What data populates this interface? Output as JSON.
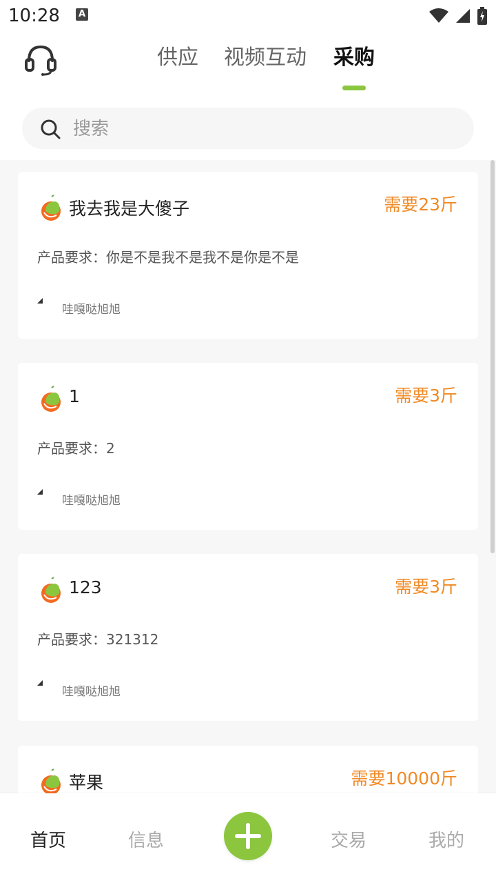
{
  "status_bar": {
    "time": "10:28",
    "notif_letter": "A"
  },
  "header": {
    "tabs": [
      {
        "label": "供应",
        "active": false
      },
      {
        "label": "视频互动",
        "active": false
      },
      {
        "label": "采购",
        "active": true
      }
    ],
    "search": {
      "placeholder": "搜索",
      "value": ""
    }
  },
  "purchases": [
    {
      "title": "我去我是大傻子",
      "quantity": "需要23斤",
      "requirement": "产品要求：你是不是我不是我不是你是不是",
      "user": "哇嘎哒旭旭"
    },
    {
      "title": "1",
      "quantity": "需要3斤",
      "requirement": "产品要求：2",
      "user": "哇嘎哒旭旭"
    },
    {
      "title": "123",
      "quantity": "需要3斤",
      "requirement": "产品要求：321312",
      "user": "哇嘎哒旭旭"
    },
    {
      "title": "苹果",
      "quantity": "需要10000斤",
      "requirement": "",
      "user": ""
    }
  ],
  "bottom_nav": {
    "items": [
      {
        "label": "首页",
        "active": true
      },
      {
        "label": "信息",
        "active": false
      },
      {
        "label": "交易",
        "active": false
      },
      {
        "label": "我的",
        "active": false
      }
    ]
  },
  "colors": {
    "accent_green": "#8cc63f",
    "quantity_orange": "#f08a24",
    "logo_orange": "#f26b21"
  },
  "icons": {
    "service": "headset-icon",
    "search": "search-icon",
    "add": "plus-icon",
    "card_logo": "fruit-logo-icon"
  }
}
